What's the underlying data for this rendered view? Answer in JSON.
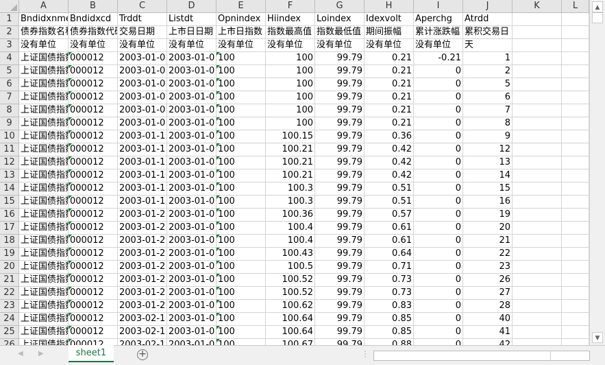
{
  "columns": [
    "A",
    "B",
    "C",
    "D",
    "E",
    "F",
    "G",
    "H",
    "I",
    "J",
    "K",
    "L"
  ],
  "header_rows": [
    [
      "Bndidxnme",
      "Bndidxcd",
      "Trddt",
      "Listdt",
      "Opnindex",
      "Hiindex",
      "Loindex",
      "Idexvolt",
      "Aperchg",
      "Atrdd"
    ],
    [
      "债券指数名称",
      "债券指数代码",
      "交易日期",
      "上市日日期",
      "上市日指数",
      "指数最高值",
      "指数最低值",
      "期间振幅",
      "累计涨跌幅",
      "累积交易日"
    ],
    [
      "没有单位",
      "没有单位",
      "没有单位",
      "没有单位",
      "没有单位",
      "没有单位",
      "没有单位",
      "没有单位",
      "没有单位",
      "天"
    ]
  ],
  "data_rows": [
    [
      "上证国债指数",
      "000012",
      "2003-01-0",
      "2003-01-0",
      "100",
      "100",
      "99.79",
      "0.21",
      "-0.21",
      "1"
    ],
    [
      "上证国债指数",
      "000012",
      "2003-01-0",
      "2003-01-0",
      "100",
      "100",
      "99.79",
      "0.21",
      "0",
      "2"
    ],
    [
      "上证国债指数",
      "000012",
      "2003-01-0",
      "2003-01-0",
      "100",
      "100",
      "99.79",
      "0.21",
      "0",
      "5"
    ],
    [
      "上证国债指数",
      "000012",
      "2003-01-0",
      "2003-01-0",
      "100",
      "100",
      "99.79",
      "0.21",
      "0",
      "6"
    ],
    [
      "上证国债指数",
      "000012",
      "2003-01-0",
      "2003-01-0",
      "100",
      "100",
      "99.79",
      "0.21",
      "0",
      "7"
    ],
    [
      "上证国债指数",
      "000012",
      "2003-01-0",
      "2003-01-0",
      "100",
      "100",
      "99.79",
      "0.21",
      "0",
      "8"
    ],
    [
      "上证国债指数",
      "000012",
      "2003-01-1",
      "2003-01-0",
      "100",
      "100.15",
      "99.79",
      "0.36",
      "0",
      "9"
    ],
    [
      "上证国债指数",
      "000012",
      "2003-01-1",
      "2003-01-0",
      "100",
      "100.21",
      "99.79",
      "0.42",
      "0",
      "12"
    ],
    [
      "上证国债指数",
      "000012",
      "2003-01-1",
      "2003-01-0",
      "100",
      "100.21",
      "99.79",
      "0.42",
      "0",
      "13"
    ],
    [
      "上证国债指数",
      "000012",
      "2003-01-1",
      "2003-01-0",
      "100",
      "100.21",
      "99.79",
      "0.42",
      "0",
      "14"
    ],
    [
      "上证国债指数",
      "000012",
      "2003-01-1",
      "2003-01-0",
      "100",
      "100.3",
      "99.79",
      "0.51",
      "0",
      "15"
    ],
    [
      "上证国债指数",
      "000012",
      "2003-01-1",
      "2003-01-0",
      "100",
      "100.3",
      "99.79",
      "0.51",
      "0",
      "16"
    ],
    [
      "上证国债指数",
      "000012",
      "2003-01-2",
      "2003-01-0",
      "100",
      "100.36",
      "99.79",
      "0.57",
      "0",
      "19"
    ],
    [
      "上证国债指数",
      "000012",
      "2003-01-2",
      "2003-01-0",
      "100",
      "100.4",
      "99.79",
      "0.61",
      "0",
      "20"
    ],
    [
      "上证国债指数",
      "000012",
      "2003-01-2",
      "2003-01-0",
      "100",
      "100.4",
      "99.79",
      "0.61",
      "0",
      "21"
    ],
    [
      "上证国债指数",
      "000012",
      "2003-01-2",
      "2003-01-0",
      "100",
      "100.43",
      "99.79",
      "0.64",
      "0",
      "22"
    ],
    [
      "上证国债指数",
      "000012",
      "2003-01-2",
      "2003-01-0",
      "100",
      "100.5",
      "99.79",
      "0.71",
      "0",
      "23"
    ],
    [
      "上证国债指数",
      "000012",
      "2003-01-2",
      "2003-01-0",
      "100",
      "100.52",
      "99.79",
      "0.73",
      "0",
      "26"
    ],
    [
      "上证国债指数",
      "000012",
      "2003-01-2",
      "2003-01-0",
      "100",
      "100.52",
      "99.79",
      "0.73",
      "0",
      "27"
    ],
    [
      "上证国债指数",
      "000012",
      "2003-01-2",
      "2003-01-0",
      "100",
      "100.62",
      "99.79",
      "0.83",
      "0",
      "28"
    ],
    [
      "上证国债指数",
      "000012",
      "2003-02-1",
      "2003-01-0",
      "100",
      "100.64",
      "99.79",
      "0.85",
      "0",
      "40"
    ],
    [
      "上证国债指数",
      "000012",
      "2003-02-1",
      "2003-01-0",
      "100",
      "100.64",
      "99.79",
      "0.85",
      "0",
      "41"
    ],
    [
      "上证国债指数",
      "000012",
      "2003-02-1",
      "2003-01-0",
      "100",
      "100.67",
      "99.79",
      "0.88",
      "0",
      "42"
    ]
  ],
  "numeric_columns": [
    5,
    6,
    7,
    8,
    9
  ],
  "text_number_columns": [
    1,
    4
  ],
  "sheet_tab": "sheet1",
  "add_sheet_icon": "plus-circle-icon",
  "accent_color": "#1e7145"
}
